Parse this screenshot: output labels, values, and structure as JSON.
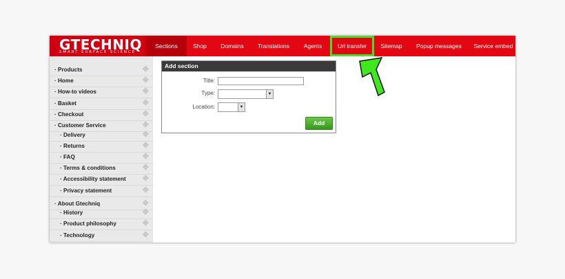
{
  "logo": {
    "main": "GTECHNIQ",
    "sub": "SMART SURFACE SCIENCE"
  },
  "nav": {
    "items": [
      {
        "label": "Sections"
      },
      {
        "label": "Shop"
      },
      {
        "label": "Domains"
      },
      {
        "label": "Translations"
      },
      {
        "label": "Agents"
      },
      {
        "label": "Url transfer"
      },
      {
        "label": "Sitemap"
      },
      {
        "label": "Popup messages"
      },
      {
        "label": "Service embed"
      }
    ],
    "active": "Sections",
    "highlighted": "Url transfer"
  },
  "sidebar": {
    "items": [
      {
        "label": "· Products"
      },
      {
        "label": "· Home"
      },
      {
        "label": "· How-to videos"
      },
      {
        "label": "· Basket"
      },
      {
        "label": "· Checkout"
      },
      {
        "label": "· Customer Service"
      },
      {
        "label": "· Delivery"
      },
      {
        "label": "· Returns"
      },
      {
        "label": "· FAQ"
      },
      {
        "label": "· Terms & conditions"
      },
      {
        "label": "· Accessibility statement"
      },
      {
        "label": "· Privacy statement"
      },
      {
        "label": "· About Gtechniq"
      },
      {
        "label": "· History"
      },
      {
        "label": "· Product philosophy"
      },
      {
        "label": "· Technology"
      }
    ],
    "handle_icon": "move-icon"
  },
  "panel": {
    "title": "Add section",
    "title_label": "Title:",
    "title_value": "",
    "type_label": "Type:",
    "type_value": "",
    "location_label": "Location:",
    "location_value": "",
    "add_button": "Add"
  },
  "colors": {
    "brand_red": "#e30613",
    "highlight_green": "#45e02a",
    "button_green": "#4caf2d"
  },
  "annotation": {
    "icon": "green-arrow-icon"
  }
}
